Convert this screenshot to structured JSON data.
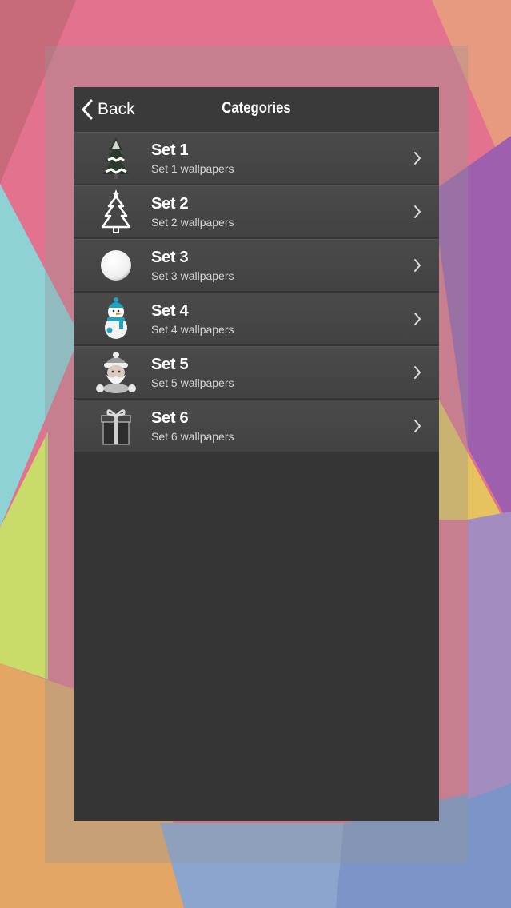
{
  "navbar": {
    "back_label": "Back",
    "title": "Categories"
  },
  "categories": [
    {
      "name": "Set 1",
      "subtitle": "Set 1 wallpapers",
      "icon": "christmas-tree-snow-icon"
    },
    {
      "name": "Set 2",
      "subtitle": "Set 2 wallpapers",
      "icon": "christmas-tree-outline-icon"
    },
    {
      "name": "Set 3",
      "subtitle": "Set 3 wallpapers",
      "icon": "white-ball-icon"
    },
    {
      "name": "Set 4",
      "subtitle": "Set 4 wallpapers",
      "icon": "snowman-icon"
    },
    {
      "name": "Set 5",
      "subtitle": "Set 5 wallpapers",
      "icon": "santa-claus-icon"
    },
    {
      "name": "Set 6",
      "subtitle": "Set 6 wallpapers",
      "icon": "gift-box-icon"
    }
  ],
  "colors": {
    "panel": "#353535",
    "row": "#464646",
    "text": "#ffffff",
    "accent": "#1fa3c4"
  }
}
